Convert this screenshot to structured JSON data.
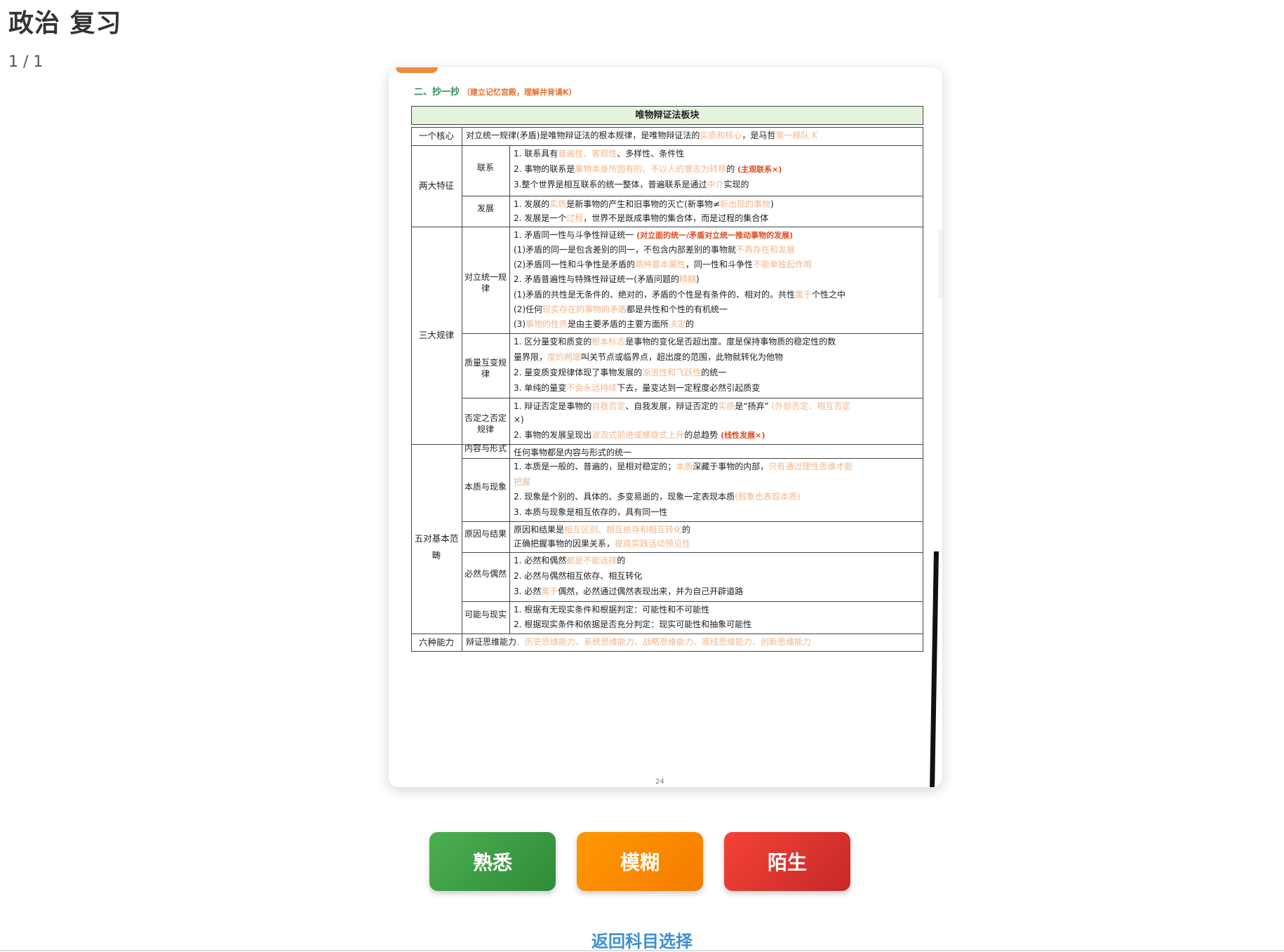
{
  "header": {
    "title": "政治 复习",
    "progress": "1 / 1"
  },
  "card": {
    "section_heading": "二、抄一抄",
    "section_sub": "（建立记忆宫殿，理解并背诵K）",
    "table_title": "唯物辩证法板块",
    "rows": [
      {
        "cat": "一个核心",
        "lines": [
          [
            "对立统一规律(矛盾)是唯物辩证法的根本规律，是唯物辩证法的",
            "实质和核心",
            "，是马哲",
            "第一梯队 K"
          ]
        ]
      },
      {
        "cat": "两大特征",
        "sub": "联系",
        "lines": [
          [
            "1. 联系具有",
            "普遍性、客观性",
            "、多样性、条件性"
          ],
          [
            "2. 事物的联系是",
            "事物本身所固有的、不以人的意志为转移",
            "的 ",
            "(主观联系×)"
          ],
          [
            "3.整个世界是相互联系的统一整体，普遍联系是通过",
            "中介",
            "实现的"
          ]
        ]
      },
      {
        "sub": "发展",
        "lines": [
          [
            "1. 发展的",
            "实质",
            "是新事物的产生和旧事物的灭亡(新事物≠",
            "新出现的事物",
            ")"
          ],
          [
            "2. 发展是一个",
            "过程",
            "，世界不是既成事物的集合体，而是过程的集合体"
          ]
        ]
      },
      {
        "cat": "三大规律",
        "sub": "对立统一规律",
        "lines": [
          [
            "1. 矛盾同一性与斗争性辩证统一 ",
            "(对立面的统一/矛盾对立统一推动事物的发展)"
          ],
          [
            "(1)矛盾的同一是包含差别的同一，不包含内部差别的事物就",
            "不再存在和发展"
          ],
          [
            "(2)矛盾同一性和斗争性是矛盾的",
            "两种基本属性",
            "，同一性和斗争性",
            "不能单独起作用"
          ],
          [
            "2. 矛盾普遍性与特殊性辩证统一(矛盾问题的",
            "精髓",
            ")"
          ],
          [
            "(1)矛盾的共性是无条件的、绝对的，矛盾的个性是有条件的、相对的。共性",
            "寓于",
            "个性之中"
          ],
          [
            "(2)任何",
            "现实存在的事物的矛盾",
            "都是共性和个性的有机统一"
          ],
          [
            "(3)",
            "事物的性质",
            "是由主要矛盾的主要方面所",
            "决定",
            "的"
          ]
        ]
      },
      {
        "sub": "质量互变规律",
        "lines": [
          [
            "1. 区分量变和质变的",
            "根本标志",
            "是事物的变化是否超出度。度是保持事物质的稳定性的数"
          ],
          [
            "量界限，",
            "度的两端",
            "叫关节点或临界点，超出度的范围，此物就转化为他物"
          ],
          [
            "2. 量变质变规律体现了事物发展的",
            "渐进性和飞跃性",
            "的统一"
          ],
          [
            "3. 单纯的量变",
            "不会永远持续",
            "下去，量变达到一定程度必然引起质变"
          ]
        ]
      },
      {
        "sub": "否定之否定规律",
        "lines": [
          [
            "1. 辩证否定是事物的",
            "自我否定",
            "、自我发展，辩证否定的",
            "实质",
            "是“扬弃” ",
            "(外部否定、相互否定"
          ],
          [
            "×)"
          ],
          [
            "2. 事物的发展呈现出",
            "波浪式前进或螺旋式上升",
            "的总趋势 ",
            "(线性发展×)"
          ]
        ]
      },
      {
        "cat": "五对基本范畴",
        "sub": "内容与形式",
        "lines": [
          [
            "任何事物都是内容与形式的统一"
          ]
        ]
      },
      {
        "sub": "本质与现象",
        "lines": [
          [
            "1. 本质是一般的、普遍的，是相对稳定的；",
            "本质",
            "深藏于事物的内部，",
            "只有通过理性思维才能"
          ],
          [
            "",
            "把握"
          ],
          [
            "2. 现象是个别的、具体的、多变易逝的，现象一定表现本质",
            "(假象也表现本质)"
          ],
          [
            "3. 本质与现象是相互依存的，具有同一性"
          ]
        ]
      },
      {
        "sub": "原因与结果",
        "lines": [
          [
            "原因和结果是",
            "相互区别、相互依存和相互转化",
            "的"
          ],
          [
            "正确把握事物的因果关系，",
            "提高实践活动预见性"
          ]
        ]
      },
      {
        "sub": "必然与偶然",
        "lines": [
          [
            "1. 必然和偶然",
            "都是不能选择",
            "的"
          ],
          [
            "2. 必然与偶然相互依存、相互转化"
          ],
          [
            "3. 必然",
            "寓于",
            "偶然，必然通过偶然表现出来，并为自己开辟道路"
          ]
        ]
      },
      {
        "sub": "可能与现实",
        "lines": [
          [
            "1. 根据有无现实条件和根据判定：可能性和不可能性"
          ],
          [
            "2. 根据现实条件和依据是否充分判定：现实可能性和抽象可能性"
          ]
        ]
      },
      {
        "cat": "六种能力",
        "lines": [
          [
            "辩证思维能力",
            "、历史思维能力、系统思维能力、战略思维能力、底线思维能力、创新思维能力"
          ]
        ]
      }
    ],
    "page_number": "24"
  },
  "buttons": {
    "familiar": "熟悉",
    "fuzzy": "模糊",
    "unfamiliar": "陌生"
  },
  "back_link": "返回科目选择",
  "colors": {
    "green": "#4caf50",
    "orange": "#ff9800",
    "red": "#f44336",
    "link": "#3d8fd1",
    "highlight": "#f4b68a"
  }
}
